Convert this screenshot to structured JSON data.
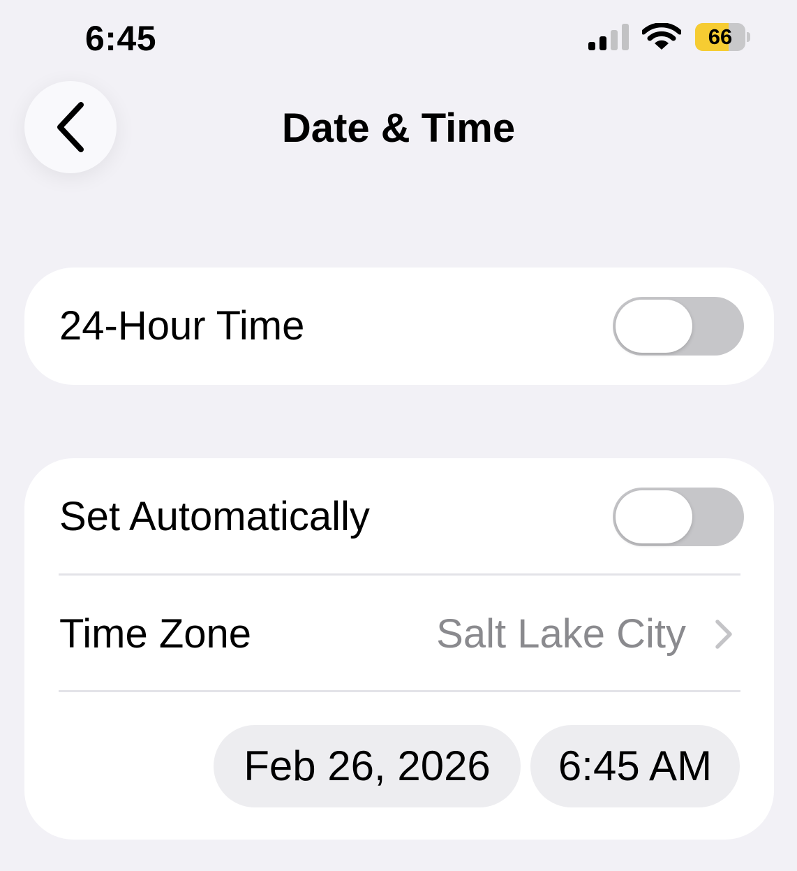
{
  "status_bar": {
    "time": "6:45",
    "battery_level": "66",
    "battery_fraction": 0.66,
    "signal_bars": 2,
    "icons": [
      "signal-icon",
      "wifi-icon",
      "battery-icon"
    ]
  },
  "nav": {
    "title": "Date & Time",
    "back_icon": "chevron-left-icon"
  },
  "settings": {
    "hour24": {
      "label": "24-Hour Time",
      "enabled": false
    },
    "set_automatically": {
      "label": "Set Automatically",
      "enabled": false
    },
    "time_zone": {
      "label": "Time Zone",
      "value": "Salt Lake City",
      "icon": "chevron-right-icon"
    },
    "date": "Feb 26, 2026",
    "time": "6:45 AM"
  },
  "colors": {
    "background": "#f2f1f6",
    "toggle_off": "#c6c6c9",
    "battery_fill": "#f6cc32",
    "secondary_text": "#8a8a8e"
  }
}
